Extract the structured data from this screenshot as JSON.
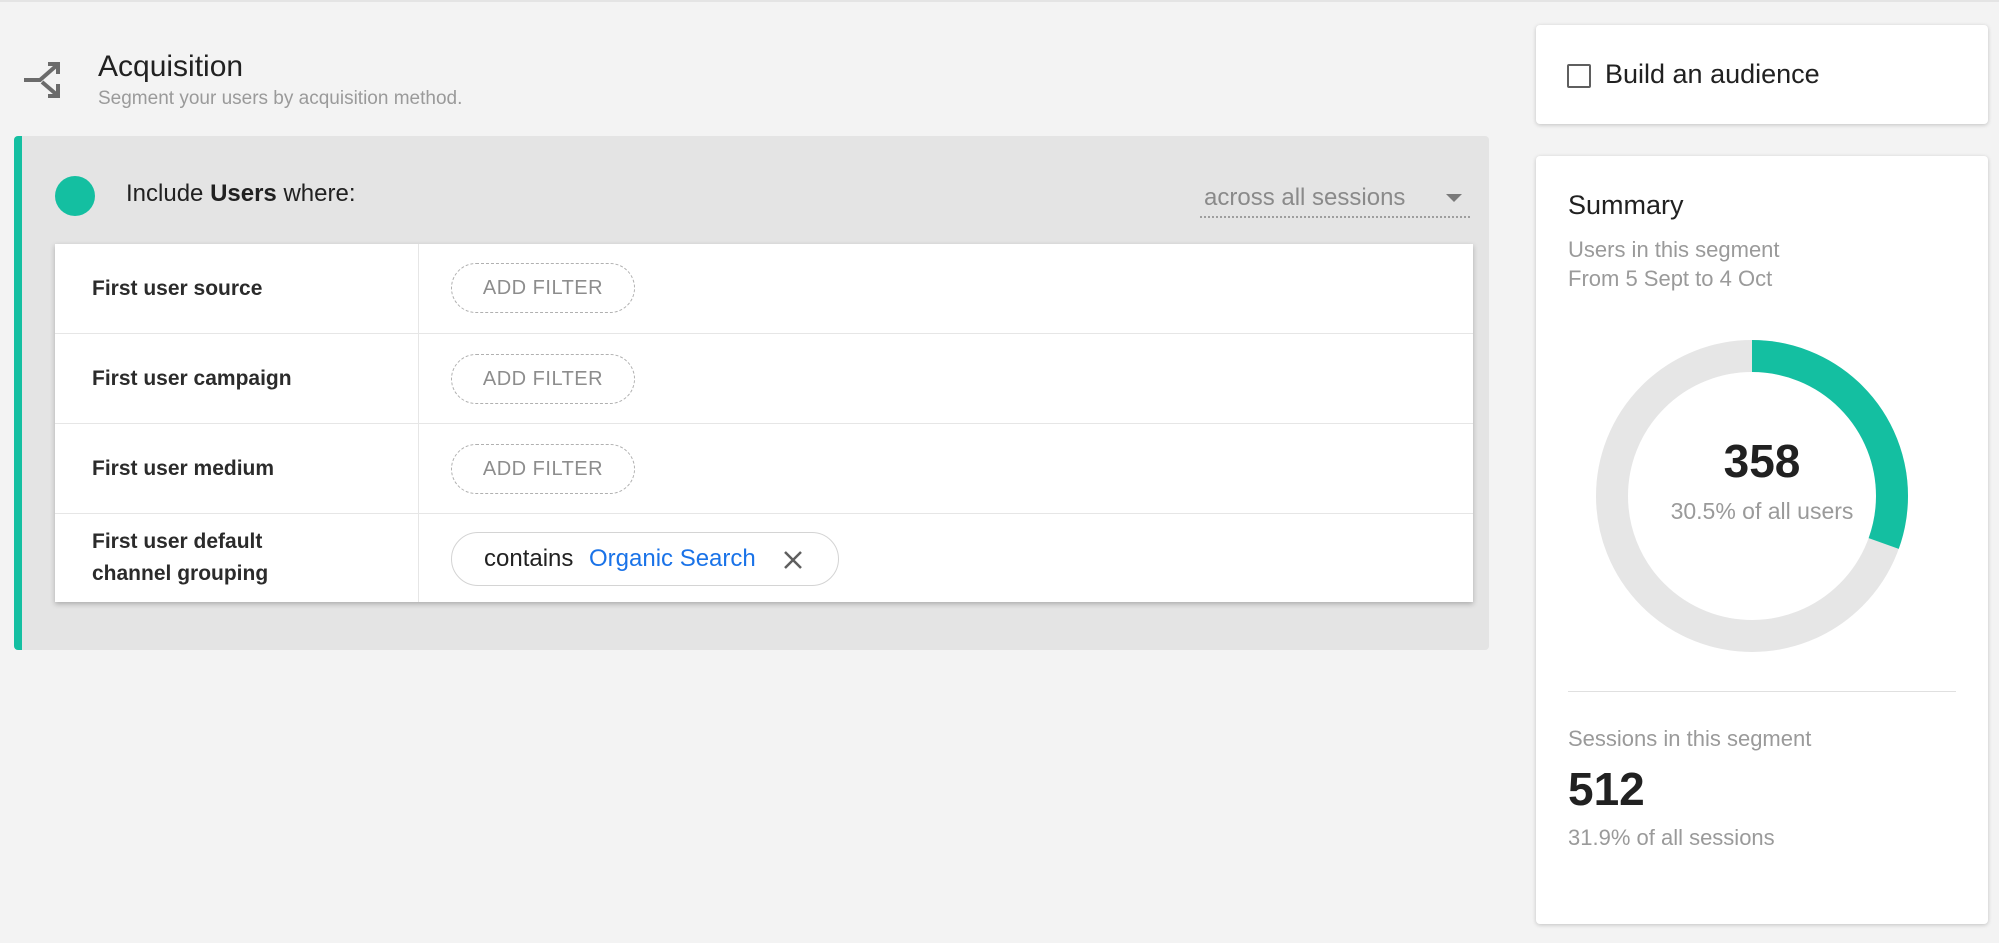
{
  "header": {
    "icon": "acquisition-merge-icon",
    "title": "Acquisition",
    "subtitle": "Segment your users by acquisition method."
  },
  "condition": {
    "prefix": "Include",
    "entity": "Users",
    "suffix": "where:",
    "scope": "across all sessions",
    "accent_color": "#14bfa1"
  },
  "filters": [
    {
      "name": "First user source",
      "action": "ADD FILTER"
    },
    {
      "name": "First user campaign",
      "action": "ADD FILTER"
    },
    {
      "name": "First user medium",
      "action": "ADD FILTER"
    },
    {
      "name_line1": "First user default",
      "name_line2": "channel grouping",
      "operator": "contains",
      "value": "Organic Search",
      "value_color": "#1a73e8"
    }
  ],
  "audience": {
    "label": "Build an audience",
    "checked": false
  },
  "summary": {
    "title": "Summary",
    "users_label": "Users in this segment",
    "date_range": "From 5 Sept to 4 Oct",
    "users_count": "358",
    "users_pct_text": "30.5% of all users",
    "users_fraction": 0.305,
    "sessions_label": "Sessions in this segment",
    "sessions_count": "512",
    "sessions_pct_text": "31.9% of all sessions",
    "donut_color": "#14bfa1",
    "donut_track_color": "#e6e6e6"
  }
}
